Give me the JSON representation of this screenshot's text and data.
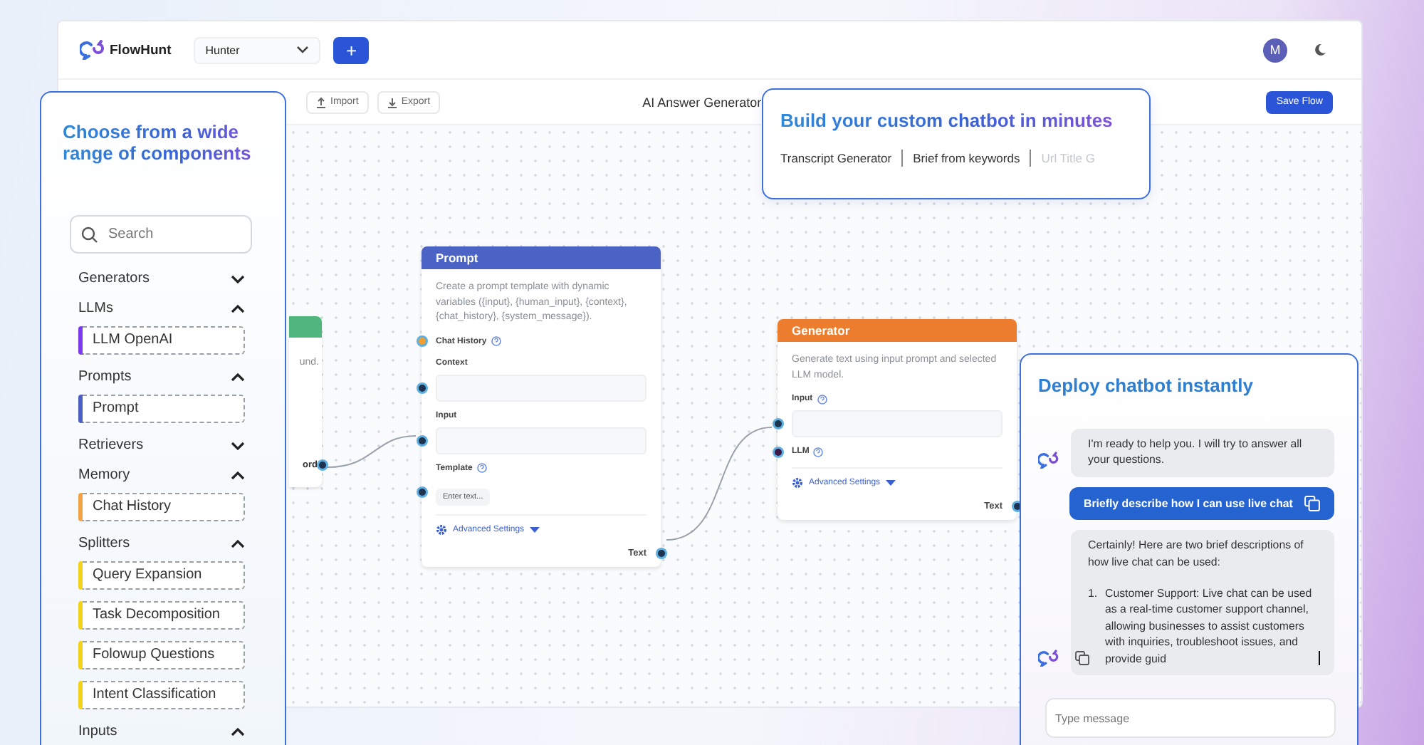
{
  "header": {
    "logo_text": "FlowHunt",
    "workspace": "Hunter",
    "add_button": "+",
    "avatar": "M"
  },
  "toolbar": {
    "buttons": [
      {
        "label": "Import",
        "kind": "import"
      },
      {
        "label": "Export",
        "kind": "export"
      }
    ],
    "flow_title": "AI Answer Generator",
    "save_button": "Save Flow"
  },
  "canvas": {
    "partial_node": {
      "color": "#4fb67d",
      "description": "und.",
      "output": "ord"
    },
    "nodes": [
      {
        "title": "Prompt",
        "color": "#4a63c4",
        "description": "Create a prompt template with dynamic variables ({input}, {human_input}, {context}, {chat_history}, {system_message}).",
        "fields": [
          {
            "label": "Chat History",
            "kind": "label",
            "help": true,
            "color": "#f0a030"
          },
          {
            "label": "Context",
            "kind": "input",
            "help": false,
            "color": "#1e3350"
          },
          {
            "label": "Input",
            "kind": "input",
            "help": false,
            "color": "#1e3350"
          },
          {
            "label": "Template",
            "kind": "text",
            "help": true,
            "color": "#1e3350",
            "placeholder": "Enter text..."
          }
        ],
        "advanced": "Advanced Settings",
        "output": "Text"
      },
      {
        "title": "Generator",
        "color": "#ec7d2e",
        "description": "Generate text using input prompt and selected LLM model.",
        "fields": [
          {
            "label": "Input",
            "kind": "input",
            "help": true,
            "color": "#1e3350"
          },
          {
            "label": "LLM",
            "kind": "label",
            "help": true,
            "color": "#3b1846"
          }
        ],
        "advanced": "Advanced Settings",
        "output": "Text"
      }
    ]
  },
  "components_panel": {
    "title": "Choose from a wide range of components",
    "search": {
      "placeholder": "Search"
    },
    "categories": [
      {
        "name": "Generators",
        "expanded": false
      },
      {
        "name": "LLMs",
        "expanded": true,
        "items": [
          {
            "label": "LLM OpenAI",
            "color": "#7c3aed"
          }
        ]
      },
      {
        "name": "Prompts",
        "expanded": true,
        "items": [
          {
            "label": "Prompt",
            "color": "#4a5fc1"
          }
        ]
      },
      {
        "name": "Retrievers",
        "expanded": false
      },
      {
        "name": "Memory",
        "expanded": true,
        "items": [
          {
            "label": "Chat History",
            "color": "#f0a447"
          }
        ]
      },
      {
        "name": "Splitters",
        "expanded": true,
        "items": [
          {
            "label": "Query Expansion",
            "color": "#f2d21f"
          },
          {
            "label": "Task Decomposition",
            "color": "#f2d21f"
          },
          {
            "label": "Folowup Questions",
            "color": "#f2d21f"
          },
          {
            "label": "Intent Classification",
            "color": "#f2d21f"
          }
        ]
      },
      {
        "name": "Inputs",
        "expanded": true
      }
    ]
  },
  "builder_card": {
    "title": "Build your custom chatbot in minutes",
    "examples": [
      {
        "label": "Transcript Generator",
        "faded": false
      },
      {
        "label": "Brief from keywords",
        "faded": false
      },
      {
        "label": "Url Title G",
        "faded": true
      }
    ]
  },
  "chat_card": {
    "title": "Deploy chatbot instantly",
    "messages": [
      {
        "kind": "bot",
        "paragraphs": [
          "I'm ready to help you. I will try to answer all your questions."
        ],
        "typing": false
      },
      {
        "kind": "user",
        "text": "Briefly describe how I can use live chat"
      },
      {
        "kind": "bot",
        "paragraphs": [
          "Certainly! Here are two brief descriptions of how live chat can be used:"
        ],
        "list": [
          {
            "number": "1.",
            "text": "Customer Support: Live chat can be used as a real-time customer support channel, allowing businesses to assist customers with inquiries, troubleshoot issues, and provide guid"
          }
        ],
        "typing": true
      }
    ],
    "input": {
      "placeholder": "Type message"
    }
  }
}
